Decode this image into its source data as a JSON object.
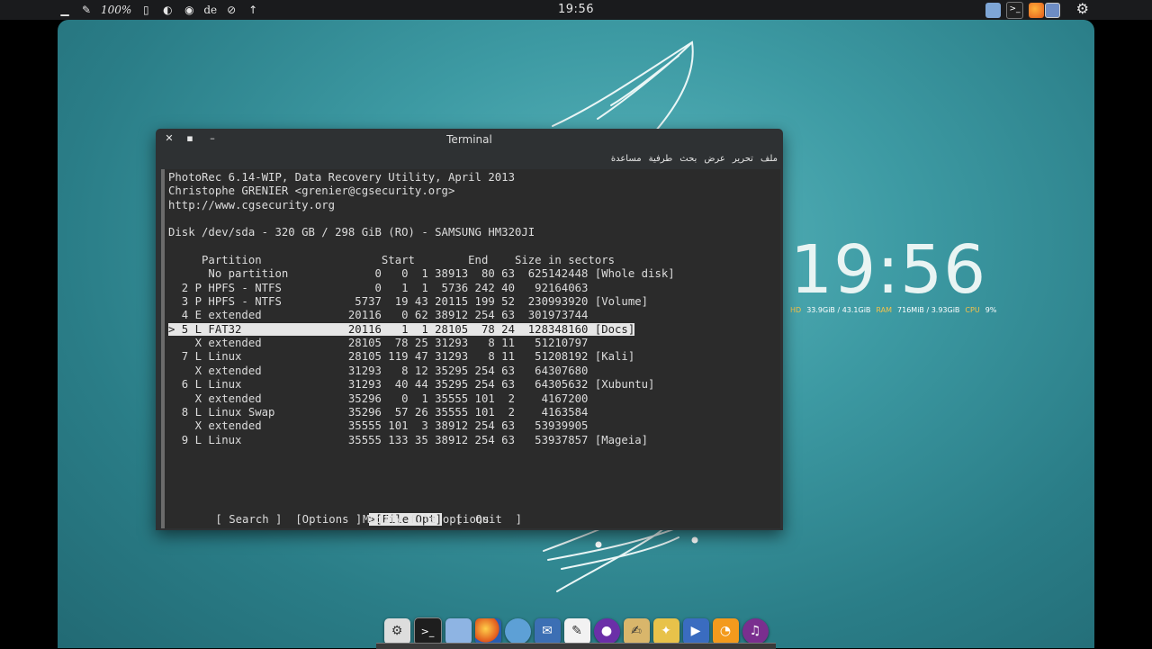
{
  "top_panel": {
    "battery_text": "100%",
    "keyboard_layout": "de",
    "clock": "19:56"
  },
  "clock_widget": {
    "time": "19:56",
    "hd_label": "HD",
    "hd_value": "33.9GiB / 43.1GiB",
    "ram_label": "RAM",
    "ram_value": "716MiB / 3.93GiB",
    "cpu_label": "CPU",
    "cpu_value": "9%"
  },
  "terminal": {
    "title": "Terminal",
    "menu": [
      "ملف",
      "تحرير",
      "عرض",
      "بحث",
      "طرفية",
      "مساعدة"
    ],
    "lines": [
      "PhotoRec 6.14-WIP, Data Recovery Utility, April 2013",
      "Christophe GRENIER <grenier@cgsecurity.org>",
      "http://www.cgsecurity.org",
      "",
      "Disk /dev/sda - 320 GB / 298 GiB (RO) - SAMSUNG HM320JI",
      "",
      "     Partition                  Start        End    Size in sectors",
      "      No partition             0   0  1 38913  80 63  625142448 [Whole disk]",
      "  2 P HPFS - NTFS              0   1  1  5736 242 40   92164063",
      "  3 P HPFS - NTFS           5737  19 43 20115 199 52  230993920 [Volume]",
      "  4 E extended             20116   0 62 38912 254 63  301973744",
      "> 5 L FAT32                20116   1  1 28105  78 24  128348160 [Docs]",
      "    X extended             28105  78 25 31293   8 11   51210797",
      "  7 L Linux                28105 119 47 31293   8 11   51208192 [Kali]",
      "    X extended             31293   8 12 35295 254 63   64307680",
      "  6 L Linux                31293  40 44 35295 254 63   64305632 [Xubuntu]",
      "    X extended             35296   0  1 35555 101  2    4167200",
      "  8 L Linux Swap           35296  57 26 35555 101  2    4163584",
      "    X extended             35555 101  3 38912 254 63   53939905",
      "  9 L Linux                35555 133 35 38912 254 63   53937857 [Mageia]"
    ],
    "selected_line_index": 11,
    "options": {
      "search": "[ Search ]",
      "options": "[Options ]",
      "file_opt": ">[File Opt]",
      "quit": "[  Quit  ]"
    },
    "hint": "Modify file options"
  },
  "colors": {
    "desktop_teal": "#3d9aa3",
    "terminal_bg": "#2b2b2b",
    "stat_label": "#f6c34a"
  }
}
